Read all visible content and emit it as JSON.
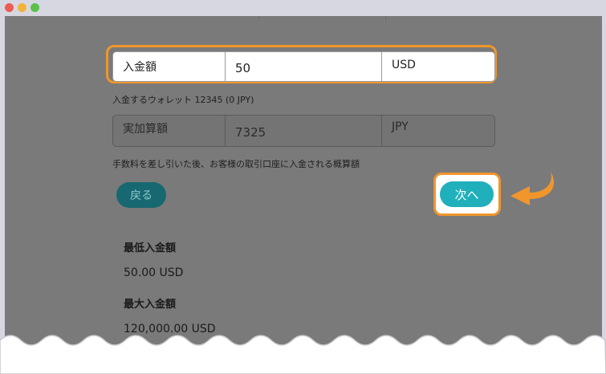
{
  "form": {
    "deposit": {
      "label": "入金額",
      "value": "50",
      "currency": "USD"
    },
    "wallet_note": "入金するウォレット 12345 (0 JPY)",
    "actual": {
      "label": "実加算額",
      "value": "7325",
      "currency": "JPY"
    },
    "fee_note": "手数料を差し引いた後、お客様の取引口座に入金される概算額"
  },
  "buttons": {
    "back": "戻る",
    "next": "次へ"
  },
  "limits": {
    "min_label": "最低入金額",
    "min_value": "50.00 USD",
    "max_label": "最大入金額",
    "max_value": "120,000.00 USD"
  },
  "colors": {
    "highlight": "#f0962b",
    "next_button": "#1fb0bc",
    "back_button": "#176870",
    "overlay": "#7a7a7a"
  }
}
